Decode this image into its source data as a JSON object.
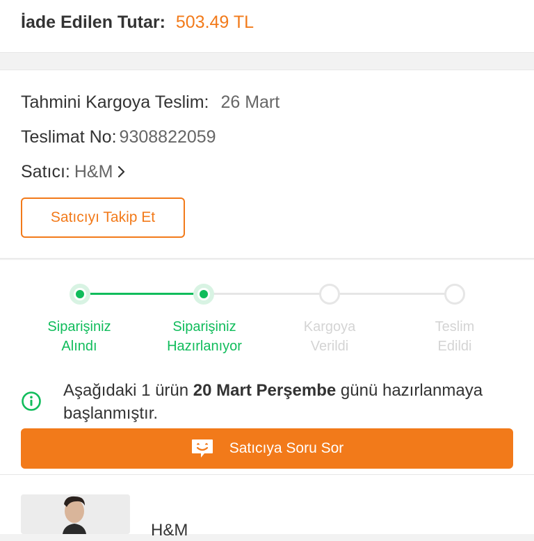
{
  "refund": {
    "label": "İade Edilen Tutar:",
    "amount": "503.49 TL"
  },
  "delivery": {
    "estimated_label": "Tahmini Kargoya Teslim:",
    "estimated_value": "26 Mart",
    "delivery_no_label": "Teslimat No:",
    "delivery_no_value": "9308822059",
    "seller_label": "Satıcı:",
    "seller_value": "H&M",
    "follow_button": "Satıcıyı Takip Et"
  },
  "status": {
    "steps": [
      {
        "line1": "Siparişiniz",
        "line2": "Alındı",
        "state": "done"
      },
      {
        "line1": "Siparişiniz",
        "line2": "Hazırlanıyor",
        "state": "done"
      },
      {
        "line1": "Kargoya",
        "line2": "Verildi",
        "state": "pending"
      },
      {
        "line1": "Teslim",
        "line2": "Edildi",
        "state": "pending"
      }
    ],
    "notice_prefix": "Aşağıdaki 1 ürün ",
    "notice_bold": "20 Mart Perşembe",
    "notice_suffix": " günü hazırlanmaya başlanmıştır.",
    "ask_button": "Satıcıya Soru Sor"
  },
  "product": {
    "brand": "H&M"
  },
  "colors": {
    "accent": "#f27a1a",
    "success": "#10bc5b",
    "pending": "#d4d4d4"
  }
}
